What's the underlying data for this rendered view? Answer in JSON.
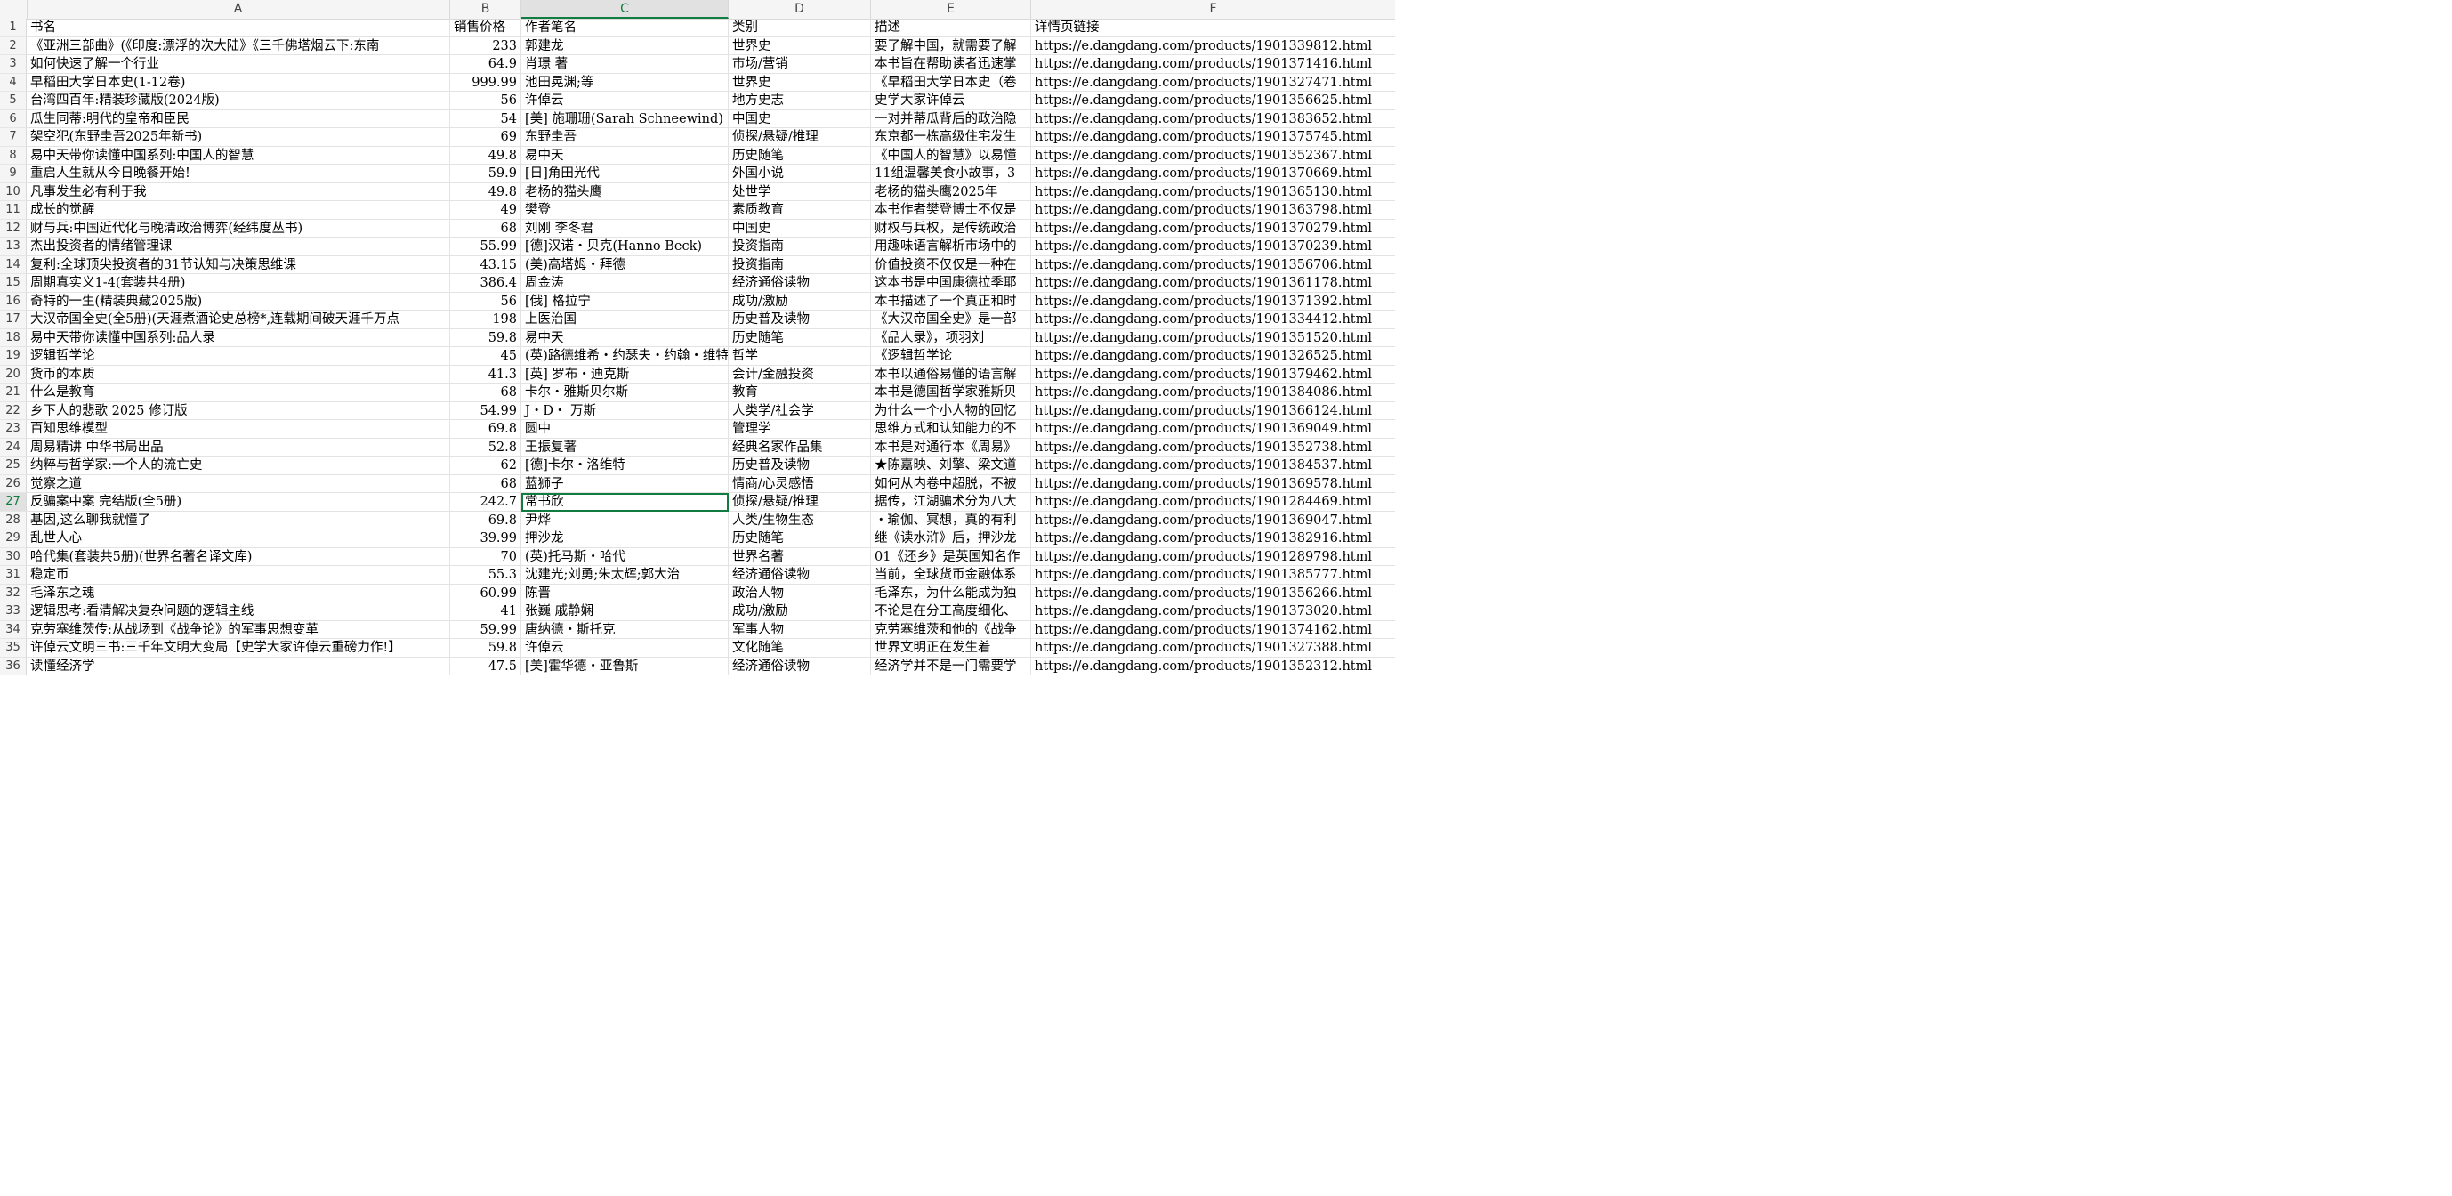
{
  "columns": [
    "A",
    "B",
    "C",
    "D",
    "E",
    "F"
  ],
  "selected_column": "C",
  "selected_row": 27,
  "rows": [
    {
      "n": "1",
      "a": "书名",
      "b": "销售价格",
      "c": "作者笔名",
      "d": "类别",
      "e": "描述",
      "f": "详情页链接",
      "header": true
    },
    {
      "n": "2",
      "a": "《亚洲三部曲》(《印度:漂浮的次大陆》《三千佛塔烟云下:东南",
      "b": "233",
      "c": "郭建龙",
      "d": "世界史",
      "e": "要了解中国，就需要了解",
      "f": "https://e.dangdang.com/products/1901339812.html"
    },
    {
      "n": "3",
      "a": "如何快速了解一个行业",
      "b": "64.9",
      "c": "肖璟 著",
      "d": "市场/营销",
      "e": "本书旨在帮助读者迅速掌",
      "f": "https://e.dangdang.com/products/1901371416.html"
    },
    {
      "n": "4",
      "a": "早稻田大学日本史(1-12卷)",
      "b": "999.99",
      "c": "池田晃渊;等",
      "d": "世界史",
      "e": "《早稻田大学日本史（卷",
      "f": "https://e.dangdang.com/products/1901327471.html"
    },
    {
      "n": "5",
      "a": "台湾四百年:精装珍藏版(2024版)",
      "b": "56",
      "c": "许倬云",
      "d": "地方史志",
      "e": "   史学大家许倬云",
      "f": "https://e.dangdang.com/products/1901356625.html"
    },
    {
      "n": "6",
      "a": "瓜生同蒂:明代的皇帝和臣民",
      "b": "54",
      "c": "[美] 施珊珊(Sarah Schneewind)",
      "d": "中国史",
      "e": "一对并蒂瓜背后的政治隐",
      "f": "https://e.dangdang.com/products/1901383652.html"
    },
    {
      "n": "7",
      "a": "架空犯(东野圭吾2025年新书)",
      "b": "69",
      "c": "东野圭吾",
      "d": "侦探/悬疑/推理",
      "e": "东京都一栋高级住宅发生",
      "f": "https://e.dangdang.com/products/1901375745.html"
    },
    {
      "n": "8",
      "a": "易中天带你读懂中国系列:中国人的智慧",
      "b": "49.8",
      "c": "易中天",
      "d": "历史随笔",
      "e": "《中国人的智慧》以易懂",
      "f": "https://e.dangdang.com/products/1901352367.html"
    },
    {
      "n": "9",
      "a": "重启人生就从今日晚餐开始!",
      "b": "59.9",
      "c": "[日]角田光代",
      "d": "外国小说",
      "e": "11组温馨美食小故事，3",
      "f": "https://e.dangdang.com/products/1901370669.html"
    },
    {
      "n": "10",
      "a": "凡事发生必有利于我",
      "b": "49.8",
      "c": "老杨的猫头鹰",
      "d": "处世学",
      "e": "  老杨的猫头鹰2025年",
      "f": "https://e.dangdang.com/products/1901365130.html"
    },
    {
      "n": "11",
      "a": "成长的觉醒",
      "b": "49",
      "c": "樊登",
      "d": "素质教育",
      "e": "本书作者樊登博士不仅是",
      "f": "https://e.dangdang.com/products/1901363798.html"
    },
    {
      "n": "12",
      "a": "财与兵:中国近代化与晚清政治博弈(经纬度丛书)",
      "b": "68",
      "c": "刘刚  李冬君",
      "d": "中国史",
      "e": "财权与兵权，是传统政治",
      "f": "https://e.dangdang.com/products/1901370279.html"
    },
    {
      "n": "13",
      "a": "杰出投资者的情绪管理课",
      "b": "55.99",
      "c": "[德]汉诺・贝克(Hanno Beck)",
      "d": "投资指南",
      "e": "用趣味语言解析市场中的",
      "f": "https://e.dangdang.com/products/1901370239.html"
    },
    {
      "n": "14",
      "a": "复利:全球顶尖投资者的31节认知与决策思维课",
      "b": "43.15",
      "c": "(美)高塔姆・拜德",
      "d": "投资指南",
      "e": "价值投资不仅仅是一种在",
      "f": "https://e.dangdang.com/products/1901356706.html"
    },
    {
      "n": "15",
      "a": "周期真实义1-4(套装共4册)",
      "b": "386.4",
      "c": "周金涛",
      "d": "经济通俗读物",
      "e": "这本书是中国康德拉季耶",
      "f": "https://e.dangdang.com/products/1901361178.html"
    },
    {
      "n": "16",
      "a": "奇特的一生(精装典藏2025版)",
      "b": "56",
      "c": "[俄] 格拉宁",
      "d": "成功/激励",
      "e": "本书描述了一个真正和时",
      "f": "https://e.dangdang.com/products/1901371392.html"
    },
    {
      "n": "17",
      "a": "大汉帝国全史(全5册)(天涯煮酒论史总榜*,连载期间破天涯千万点",
      "b": "198",
      "c": "上医治国",
      "d": "历史普及读物",
      "e": "《大汉帝国全史》是一部",
      "f": "https://e.dangdang.com/products/1901334412.html"
    },
    {
      "n": "18",
      "a": "易中天带你读懂中国系列:品人录",
      "b": "59.8",
      "c": "易中天",
      "d": "历史随笔",
      "e": "   《品人录》，项羽刘",
      "f": "https://e.dangdang.com/products/1901351520.html"
    },
    {
      "n": "19",
      "a": "逻辑哲学论",
      "b": "45",
      "c": "(英)路德维希・约瑟夫・约翰・维特根斯坦",
      "d": "哲学",
      "e": "     《逻辑哲学论",
      "f": "https://e.dangdang.com/products/1901326525.html"
    },
    {
      "n": "20",
      "a": "货币的本质",
      "b": "41.3",
      "c": "[英] 罗布・迪克斯",
      "d": "会计/金融投资",
      "e": "本书以通俗易懂的语言解",
      "f": "https://e.dangdang.com/products/1901379462.html"
    },
    {
      "n": "21",
      "a": "什么是教育",
      "b": "68",
      "c": "卡尔・雅斯贝尔斯",
      "d": "教育",
      "e": "本书是德国哲学家雅斯贝",
      "f": "https://e.dangdang.com/products/1901384086.html"
    },
    {
      "n": "22",
      "a": "乡下人的悲歌 2025 修订版",
      "b": "54.99",
      "c": "J・D・ 万斯",
      "d": "人类学/社会学",
      "e": "为什么一个小人物的回忆",
      "f": "https://e.dangdang.com/products/1901366124.html"
    },
    {
      "n": "23",
      "a": "百知思维模型",
      "b": "69.8",
      "c": "圆中",
      "d": "管理学",
      "e": "思维方式和认知能力的不",
      "f": "https://e.dangdang.com/products/1901369049.html"
    },
    {
      "n": "24",
      "a": "周易精讲  中华书局出品",
      "b": "52.8",
      "c": "王振复著",
      "d": "经典名家作品集",
      "e": "本书是对通行本《周易》",
      "f": "https://e.dangdang.com/products/1901352738.html"
    },
    {
      "n": "25",
      "a": "纳粹与哲学家:一个人的流亡史",
      "b": "62",
      "c": "[德]卡尔・洛维特",
      "d": "历史普及读物",
      "e": "★陈嘉映、刘擎、梁文道",
      "f": "https://e.dangdang.com/products/1901384537.html"
    },
    {
      "n": "26",
      "a": "觉察之道",
      "b": "68",
      "c": "蓝狮子",
      "d": "情商/心灵感悟",
      "e": "如何从内卷中超脱，不被",
      "f": "https://e.dangdang.com/products/1901369578.html"
    },
    {
      "n": "27",
      "a": "反骗案中案 完结版(全5册)",
      "b": "242.7",
      "c": "常书欣",
      "d": "侦探/悬疑/推理",
      "e": "据传，江湖骗术分为八大",
      "f": "https://e.dangdang.com/products/1901284469.html"
    },
    {
      "n": "28",
      "a": "基因,这么聊我就懂了",
      "b": "69.8",
      "c": "尹烨",
      "d": "人类/生物生态",
      "e": "・瑜伽、冥想，真的有利",
      "f": "https://e.dangdang.com/products/1901369047.html"
    },
    {
      "n": "29",
      "a": "乱世人心",
      "b": "39.99",
      "c": "押沙龙",
      "d": "历史随笔",
      "e": "继《读水浒》后，押沙龙",
      "f": "https://e.dangdang.com/products/1901382916.html"
    },
    {
      "n": "30",
      "a": "哈代集(套装共5册)(世界名著名译文库)",
      "b": "70",
      "c": "(英)托马斯・哈代",
      "d": "世界名著",
      "e": "01《还乡》是英国知名作",
      "f": "https://e.dangdang.com/products/1901289798.html"
    },
    {
      "n": "31",
      "a": "稳定币",
      "b": "55.3",
      "c": "沈建光;刘勇;朱太辉;郭大治",
      "d": "经济通俗读物",
      "e": "当前，全球货币金融体系",
      "f": "https://e.dangdang.com/products/1901385777.html"
    },
    {
      "n": "32",
      "a": "毛泽东之魂",
      "b": "60.99",
      "c": "陈晋",
      "d": "政治人物",
      "e": "毛泽东，为什么能成为独",
      "f": "https://e.dangdang.com/products/1901356266.html"
    },
    {
      "n": "33",
      "a": "逻辑思考:看清解决复杂问题的逻辑主线",
      "b": "41",
      "c": "张巍 戚静娴",
      "d": "成功/激励",
      "e": "不论是在分工高度细化、",
      "f": "https://e.dangdang.com/products/1901373020.html"
    },
    {
      "n": "34",
      "a": "克劳塞维茨传:从战场到《战争论》的军事思想变革",
      "b": "59.99",
      "c": "唐纳德・斯托克",
      "d": "军事人物",
      "e": "克劳塞维茨和他的《战争",
      "f": "https://e.dangdang.com/products/1901374162.html"
    },
    {
      "n": "35",
      "a": "许倬云文明三书:三千年文明大变局【史学大家许倬云重磅力作!】",
      "b": "59.8",
      "c": "许倬云",
      "d": "文化随笔",
      "e": "   世界文明正在发生着",
      "f": "https://e.dangdang.com/products/1901327388.html"
    },
    {
      "n": "36",
      "a": "读懂经济学",
      "b": "47.5",
      "c": "[美]霍华德・亚鲁斯",
      "d": "经济通俗读物",
      "e": "经济学并不是一门需要学",
      "f": "https://e.dangdang.com/products/1901352312.html"
    }
  ]
}
